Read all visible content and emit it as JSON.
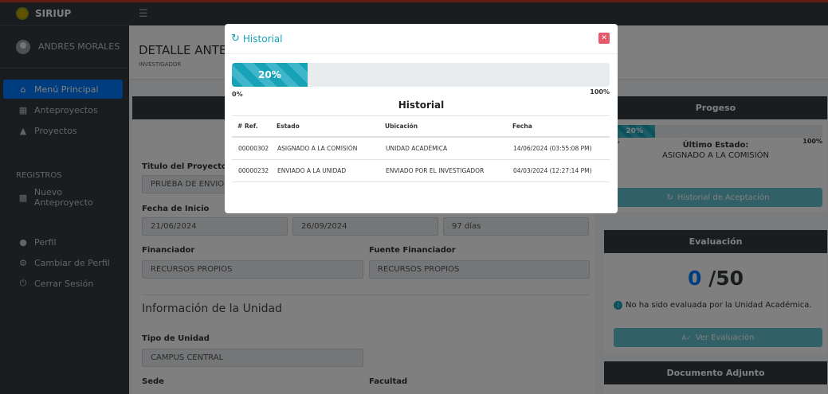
{
  "brand": {
    "name": "SIRIUP"
  },
  "user": {
    "name": "ANDRES MORALES"
  },
  "sidebar": {
    "items": [
      {
        "label": "Menú Principal",
        "icon": "home-icon"
      },
      {
        "label": "Anteproyectos",
        "icon": "users-icon"
      },
      {
        "label": "Proyectos",
        "icon": "graduation-cap-icon"
      }
    ],
    "section_registros": "REGISTROS",
    "registros_items": [
      {
        "label": "Nuevo Anteproyecto",
        "icon": "clipboard-icon"
      }
    ],
    "account_items": [
      {
        "label": "Perfil",
        "icon": "user-icon"
      },
      {
        "label": "Cambiar de Perfil",
        "icon": "cogs-icon"
      },
      {
        "label": "Cerrar Sesión",
        "icon": "power-icon"
      }
    ]
  },
  "page": {
    "title": "DETALLE ANTEPR",
    "subtitle": "INVESTIGADOR"
  },
  "form": {
    "titulo_label": "Titulo del Proyecto",
    "titulo_value": "PRUEBA DE ENVIO DE",
    "fecha_inicio_label": "Fecha de Inicio",
    "fecha_inicio_value": "21/06/2024",
    "fecha_fin_value": "26/09/2024",
    "duracion_value": "97 días",
    "financiador_label": "Financiador",
    "financiador_value": "RECURSOS PROPIOS",
    "fuente_label": "Fuente Financiador",
    "fuente_value": "RECURSOS PROPIOS",
    "unidad_section": "Información de la Unidad",
    "tipo_unidad_label": "Tipo de Unidad",
    "tipo_unidad_value": "CAMPUS CENTRAL",
    "sede_label": "Sede",
    "facultad_label": "Facultad"
  },
  "progreso": {
    "header": "Progeso",
    "percent": 20,
    "percent_label": "20%",
    "min_label": "%",
    "max_label": "100%",
    "ultimo_estado_label": "Último Estado:",
    "ultimo_estado_value": "ASIGNADO A LA COMISIÓN",
    "historial_btn": "Historial de Aceptación"
  },
  "evaluacion": {
    "header": "Evaluación",
    "score": "0",
    "total": "/50",
    "info_text": "No ha sido evaluada por la Unidad Académica.",
    "ver_btn": "Ver Evaluación"
  },
  "documento": {
    "header": "Documento Adjunto"
  },
  "modal": {
    "title": "Historial",
    "percent": 20,
    "percent_label": "20%",
    "min_label": "0%",
    "max_label": "100%",
    "table_title": "Historial",
    "columns": [
      "# Ref.",
      "Estado",
      "Ubicación",
      "Fecha"
    ],
    "rows": [
      [
        "00000302",
        "ASIGNADO A LA COMISIÓN",
        "UNIDAD ACADÉMICA",
        "14/06/2024 (03:55:08 PM)"
      ],
      [
        "00000232",
        "ENVIADO A LA UNIDAD",
        "ENVIADO POR EL INVESTIGADOR",
        "04/03/2024 (12:27:14 PM)"
      ]
    ]
  }
}
